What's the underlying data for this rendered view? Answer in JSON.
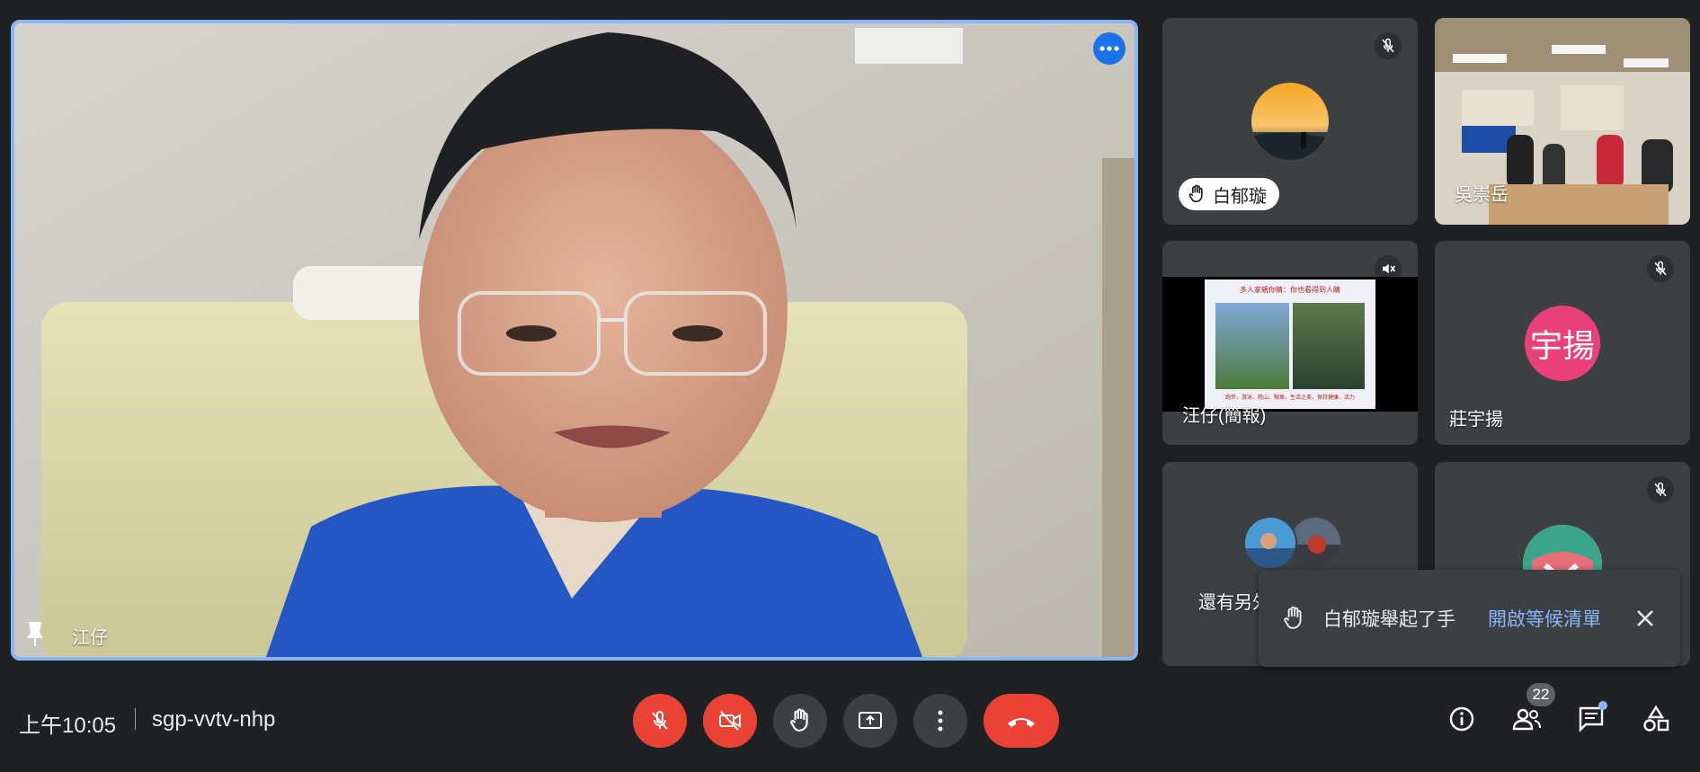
{
  "main_speaker": {
    "name": "江仔"
  },
  "participants": [
    {
      "name": "白郁璇",
      "raised_hand": true
    },
    {
      "name": "吳崇岳"
    },
    {
      "name": "汪仔(簡報)",
      "slide_title": "多人家親你睛：你也看得到人睛",
      "slide_caption": "跑步、游泳、爬山、騎車、生活之美，保持健康、活力"
    },
    {
      "name": "莊宇揚",
      "initials": "宇揚",
      "avatar_color": "#e91e63"
    },
    {
      "name": "還有另外"
    }
  ],
  "meeting": {
    "time": "上午10:05",
    "code": "sgp-vvtv-nhp"
  },
  "participant_count": "22",
  "toast": {
    "message": "白郁璇舉起了手",
    "action": "開啟等候清單"
  },
  "colors": {
    "accent": "#8ab4f8",
    "danger": "#ea4335",
    "control": "#3c4043"
  }
}
